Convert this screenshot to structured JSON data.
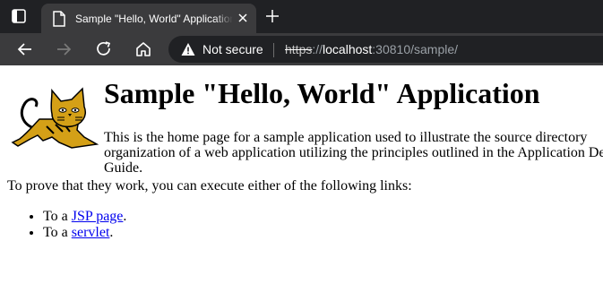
{
  "browser": {
    "tab": {
      "title": "Sample \"Hello, World\" Application",
      "favicon": "page-icon",
      "close_icon": "close-icon"
    },
    "new_tab_icon": "plus-icon",
    "tab_actions_icon": "tab-actions-icon",
    "toolbar": {
      "back_icon": "back-arrow-icon",
      "forward_icon": "forward-arrow-icon",
      "refresh_icon": "refresh-icon",
      "home_icon": "home-icon"
    },
    "address": {
      "security_icon": "warning-icon",
      "security_label": "Not secure",
      "url_scheme": "https",
      "url_separator": "://",
      "url_host": "localhost",
      "url_rest": ":30810/sample/"
    }
  },
  "page": {
    "title": "Sample \"Hello, World\" Application",
    "intro": "This is the home page for a sample application used to illustrate the source directory organization of a web application utilizing the principles outlined in the Application Developer's Guide.",
    "prove_text": "To prove that they work, you can execute either of the following links:",
    "links": [
      {
        "prefix": "To a ",
        "link_text": "JSP page",
        "suffix": "."
      },
      {
        "prefix": "To a ",
        "link_text": "servlet",
        "suffix": "."
      }
    ],
    "logo_icon": "tomcat-logo"
  },
  "colors": {
    "chrome_dark": "#202124",
    "chrome_tab": "#3b3b3d",
    "link": "#0000ee"
  }
}
